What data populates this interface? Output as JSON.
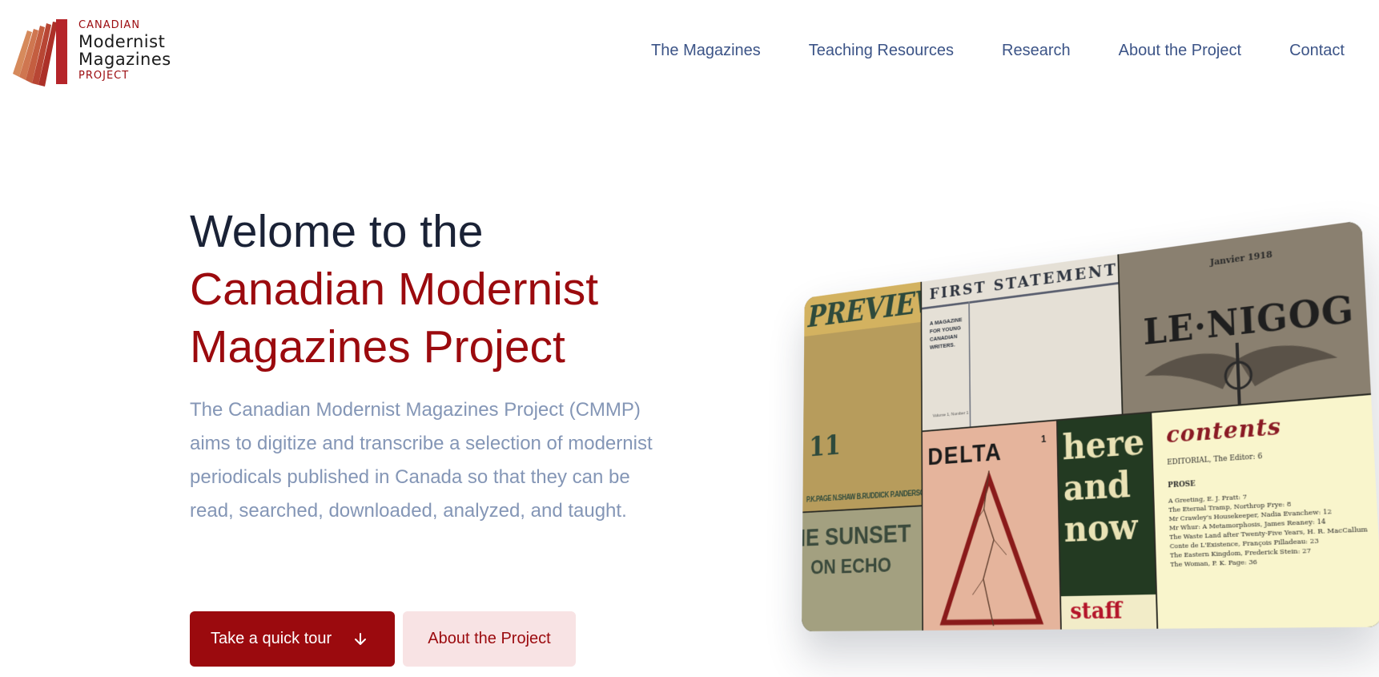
{
  "brand": {
    "line1": "CANADIAN",
    "line2": "Modernist",
    "line3": "Magazines",
    "line4": "PROJECT",
    "colors": {
      "accent": "#9b0a0e",
      "nav": "#3c5487",
      "text": "#1a2236",
      "muted": "#8496b6",
      "soft_button": "#f8e3e4"
    }
  },
  "nav": {
    "items": [
      {
        "label": "The Magazines"
      },
      {
        "label": "Teaching Resources"
      },
      {
        "label": "Research"
      },
      {
        "label": "About the Project"
      },
      {
        "label": "Contact"
      }
    ]
  },
  "hero": {
    "title_lead": "Welome to the",
    "title_accent": "Canadian Modernist Magazines Project",
    "description": "The Canadian Modernist Magazines Project (CMMP) aims to digitize and transcribe a selection of modernist periodicals published in Canada so that they can be read, searched, downloaded, analyzed, and taught.",
    "primary_button": "Take a quick tour",
    "primary_button_icon": "arrow-down-icon",
    "secondary_button": "About the Project"
  },
  "collage": {
    "preview_title": "PREVIEW",
    "preview_issue": "11",
    "preview_names": "P.K.PAGE N.SHAW B.RUDDICK P.ANDERSON F.R.SCOTT",
    "sunset_line1": "IE SUNSET",
    "sunset_line2": "ON ECHO",
    "first_title": "FIRST STATEMENT",
    "first_subtitle": "A MAGAZINE\nFOR YOUNG\nCANADIAN\nWRITERS.",
    "first_volume": "Volume 1, Number 1",
    "nigog_date": "Janvier 1918",
    "nigog_title": "LE·NIGOG",
    "delta_title": "DELTA",
    "delta_issue": "1",
    "here_title": "here and now",
    "here_staff": "staff",
    "contents_title": "contents",
    "contents_editorial": "EDITORIAL, The Editor: 6",
    "contents_section": "PROSE",
    "contents_items": [
      "A Greeting, E. J. Pratt: 7",
      "The Eternal Tramp, Northrop Frye: 8",
      "Mr Crawley's Housekeeper, Nadia Evanchew: 12",
      "Mr Whur: A Metamorphosis, James Reaney: 14",
      "The Waste Land after Twenty-Five Years, H. R. MacCallum",
      "Conte de L'Existence, François Pilladeau: 23",
      "The Eastern Kingdom, Frederick Stein: 27",
      "The Woman, P. K. Page: 36"
    ]
  }
}
